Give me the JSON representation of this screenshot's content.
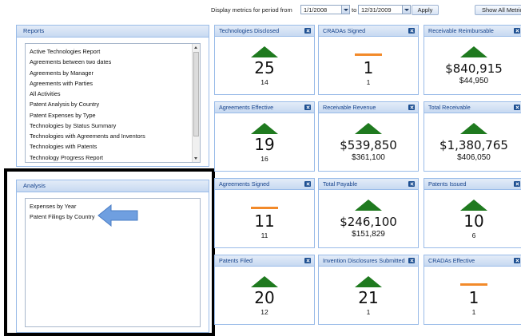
{
  "toolbar": {
    "period_label": "Display metrics for period from",
    "from_date": "1/1/2008",
    "to_label": "to",
    "to_date": "12/31/2009",
    "apply_label": "Apply",
    "show_all_label": "Show All Metrics"
  },
  "reports": {
    "title": "Reports",
    "items": [
      "Active Technologies Report",
      "Agreements between two dates",
      "Agreements by Manager",
      "Agreements with Parties",
      "All Activities",
      "Patent Analysis by Country",
      "Patent Expenses by Type",
      "Technologies by Status Summary",
      "Technologies with Agreements and Inventors",
      "Technologies with Patents",
      "Technology Progress Report"
    ]
  },
  "analysis": {
    "title": "Analysis",
    "items": [
      "Expenses by Year",
      "Patent Filings by Country"
    ]
  },
  "tiles": [
    {
      "title": "Technologies Disclosed",
      "trend": "up",
      "value": "25",
      "previous": "14"
    },
    {
      "title": "CRADAs Signed",
      "trend": "flat",
      "value": "1",
      "previous": "1"
    },
    {
      "title": "Receivable Reimbursable",
      "trend": "up",
      "value": "$840,915",
      "previous": "$44,950"
    },
    {
      "title": "Agreements Effective",
      "trend": "up",
      "value": "19",
      "previous": "16"
    },
    {
      "title": "Receivable Revenue",
      "trend": "up",
      "value": "$539,850",
      "previous": "$361,100"
    },
    {
      "title": "Total Receivable",
      "trend": "up",
      "value": "$1,380,765",
      "previous": "$406,050"
    },
    {
      "title": "Agreements Signed",
      "trend": "flat",
      "value": "11",
      "previous": "11"
    },
    {
      "title": "Total Payable",
      "trend": "up",
      "value": "$246,100",
      "previous": "$151,829"
    },
    {
      "title": "Patents Issued",
      "trend": "up",
      "value": "10",
      "previous": "6"
    },
    {
      "title": "Patents Filed",
      "trend": "up",
      "value": "20",
      "previous": "12"
    },
    {
      "title": "Invention Disclosures Submitted",
      "trend": "up",
      "value": "21",
      "previous": "1"
    },
    {
      "title": "CRADAs Effective",
      "trend": "flat",
      "value": "1",
      "previous": "1"
    }
  ],
  "colors": {
    "up": "#1f7a1f",
    "flat": "#f28a2a",
    "header": "#c7d9f1",
    "annotation_arrow": "#6f9fe0"
  }
}
